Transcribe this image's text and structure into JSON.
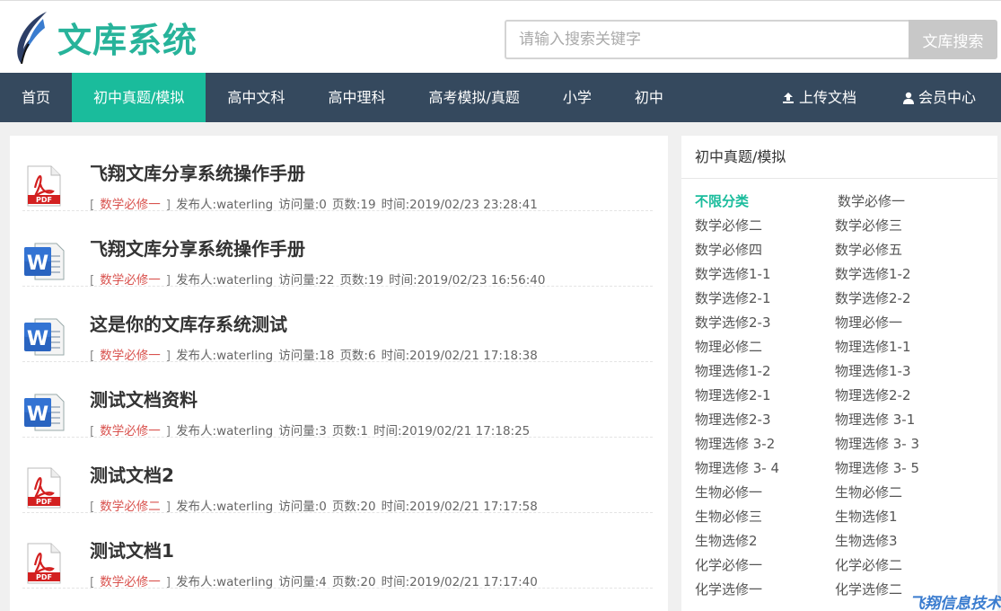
{
  "brand": {
    "name": "文库系统"
  },
  "search": {
    "placeholder": "请输入搜索关键字",
    "button_label": "文库搜索"
  },
  "nav": {
    "items": [
      "首页",
      "初中真题/模拟",
      "高中文科",
      "高中理科",
      "高考模拟/真题",
      "小学",
      "初中"
    ],
    "active_index": 1,
    "upload_label": "上传文档",
    "member_label": "会员中心"
  },
  "documents": [
    {
      "type": "pdf",
      "title": "飞翔文库分享系统操作手册",
      "category": "数学必修一",
      "publisher": "发布人:waterling",
      "views": "访问量:0",
      "pages": "页数:19",
      "time": "时间:2019/02/23 23:28:41"
    },
    {
      "type": "word",
      "title": "飞翔文库分享系统操作手册",
      "category": "数学必修一",
      "publisher": "发布人:waterling",
      "views": "访问量:22",
      "pages": "页数:19",
      "time": "时间:2019/02/23 16:56:40"
    },
    {
      "type": "word",
      "title": "这是你的文库存系统测试",
      "category": "数学必修一",
      "publisher": "发布人:waterling",
      "views": "访问量:18",
      "pages": "页数:6",
      "time": "时间:2019/02/21 17:18:38"
    },
    {
      "type": "word",
      "title": "测试文档资料",
      "category": "数学必修一",
      "publisher": "发布人:waterling",
      "views": "访问量:3",
      "pages": "页数:1",
      "time": "时间:2019/02/21 17:18:25"
    },
    {
      "type": "pdf",
      "title": "测试文档2",
      "category": "数学必修二",
      "publisher": "发布人:waterling",
      "views": "访问量:0",
      "pages": "页数:20",
      "time": "时间:2019/02/21 17:17:58"
    },
    {
      "type": "pdf",
      "title": "测试文档1",
      "category": "数学必修一",
      "publisher": "发布人:waterling",
      "views": "访问量:4",
      "pages": "页数:20",
      "time": "时间:2019/02/21 17:17:40"
    }
  ],
  "sidebar": {
    "title": "初中真题/模拟",
    "categories": [
      "不限分类",
      "数学必修一",
      "数学必修二",
      "数学必修三",
      "数学必修四",
      "数学必修五",
      "数学选修1-1",
      "数学选修1-2",
      "数学选修2-1",
      "数学选修2-2",
      "数学选修2-3",
      "物理必修一",
      "物理必修二",
      "物理选修1-1",
      "物理选修1-2",
      "物理选修1-3",
      "物理选修2-1",
      "物理选修2-2",
      "物理选修2-3",
      "物理选修 3-1",
      "物理选修 3-2",
      "物理选修 3- 3",
      "物理选修 3- 4",
      "物理选修 3- 5",
      "生物必修一",
      "生物必修二",
      "生物必修三",
      "生物选修1",
      "生物选修2",
      "生物选修3",
      "化学必修一",
      "化学必修二",
      "化学选修一",
      "化学选修二"
    ],
    "active_index": 0
  },
  "watermark": "飞翔信息技术",
  "colors": {
    "accent": "#1abc9c",
    "nav_bg": "#35495e",
    "category": "#d9534f",
    "brand": "#27b39a"
  }
}
